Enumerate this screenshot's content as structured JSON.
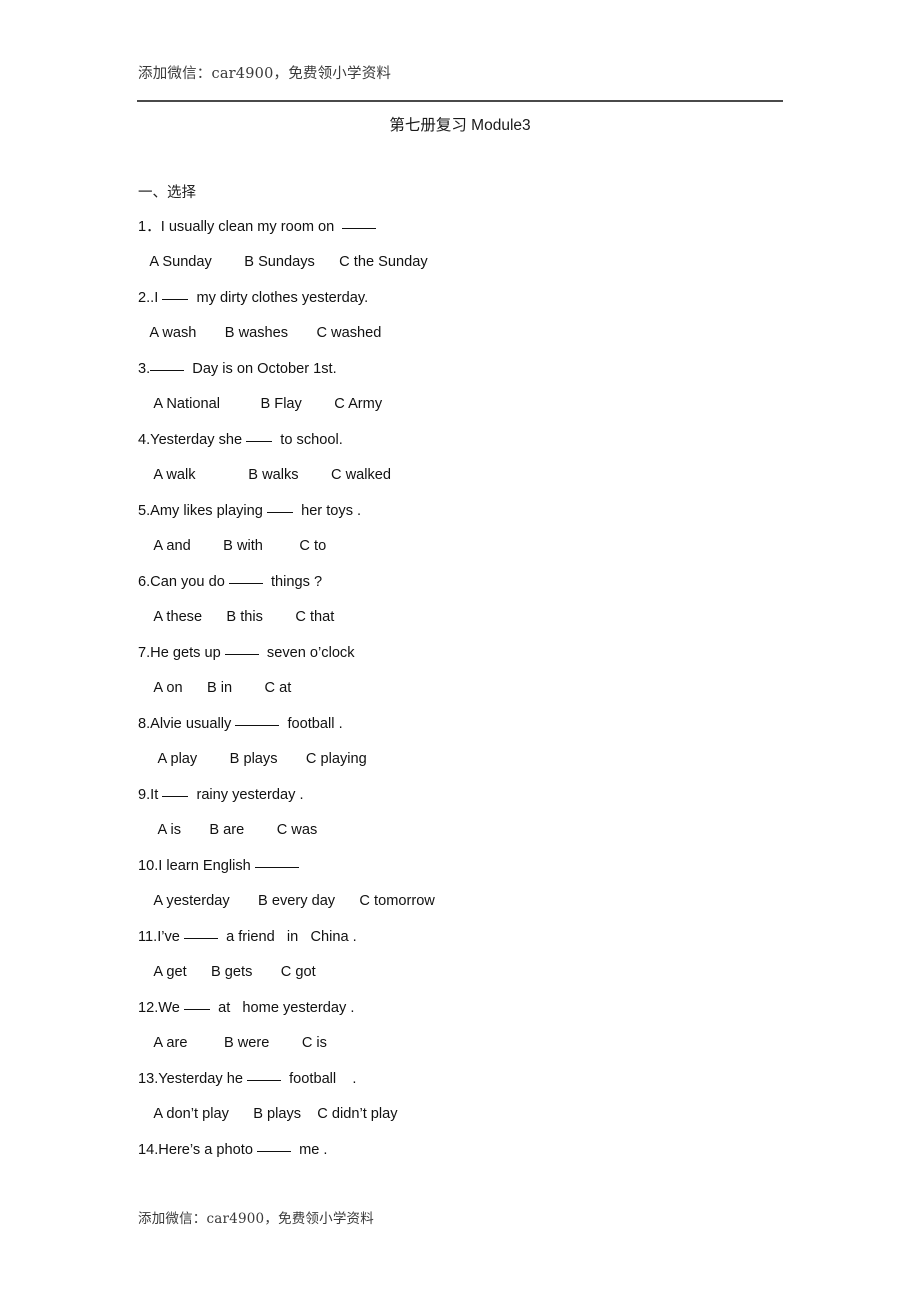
{
  "header": {
    "watermark": "添加微信：car4900，免费领小学资料"
  },
  "title": {
    "text": "第七册复习 Module3"
  },
  "section": {
    "heading": "一、选择"
  },
  "questions": [
    {
      "stem_before": "1．I usually clean my room on  ",
      "blank": "b4",
      "stem_after": "",
      "options": "   A Sunday        B Sundays      C the Sunday"
    },
    {
      "stem_before": "2..I ",
      "blank": "b3",
      "stem_after": "  my dirty clothes yesterday.",
      "options": "   A wash       B washes       C washed"
    },
    {
      "stem_before": "3.",
      "blank": "b4",
      "stem_after": "  Day is on October 1st.",
      "options": "    A National          B Flay        C Army"
    },
    {
      "stem_before": "4.Yesterday she ",
      "blank": "b3",
      "stem_after": "  to school.",
      "options": "    A walk             B walks        C walked"
    },
    {
      "stem_before": "5.Amy likes playing ",
      "blank": "b3",
      "stem_after": "  her toys .",
      "options": "    A and        B with         C to"
    },
    {
      "stem_before": "6.Can you do ",
      "blank": "b4",
      "stem_after": "  things ?",
      "options": "    A these      B this        C that"
    },
    {
      "stem_before": "7.He gets up ",
      "blank": "b4",
      "stem_after": "  seven o’clock",
      "options": "    A on      B in        C at"
    },
    {
      "stem_before": "8.Alvie usually ",
      "blank": "b5",
      "stem_after": "  football .",
      "options": "     A play        B plays       C playing"
    },
    {
      "stem_before": "9.It ",
      "blank": "b3",
      "stem_after": "  rainy yesterday .",
      "options": "     A is       B are        C was"
    },
    {
      "stem_before": "10.I learn English ",
      "blank": "b5",
      "stem_after": "",
      "options": "    A yesterday       B every day      C tomorrow"
    },
    {
      "stem_before": "11.I’ve ",
      "blank": "b4",
      "stem_after": "  a friend   in   China .",
      "options": "    A get      B gets       C got"
    },
    {
      "stem_before": "12.We ",
      "blank": "b3",
      "stem_after": "  at   home yesterday .",
      "options": "    A are         B were        C is"
    },
    {
      "stem_before": "13.Yesterday he ",
      "blank": "b4",
      "stem_after": "  football    .",
      "options": "    A don’t play      B plays    C didn’t play"
    },
    {
      "stem_before": "14.Here’s a photo ",
      "blank": "b4",
      "stem_after": "  me .",
      "options": ""
    }
  ],
  "footer": {
    "watermark": "添加微信：car4900，免费领小学资料"
  }
}
